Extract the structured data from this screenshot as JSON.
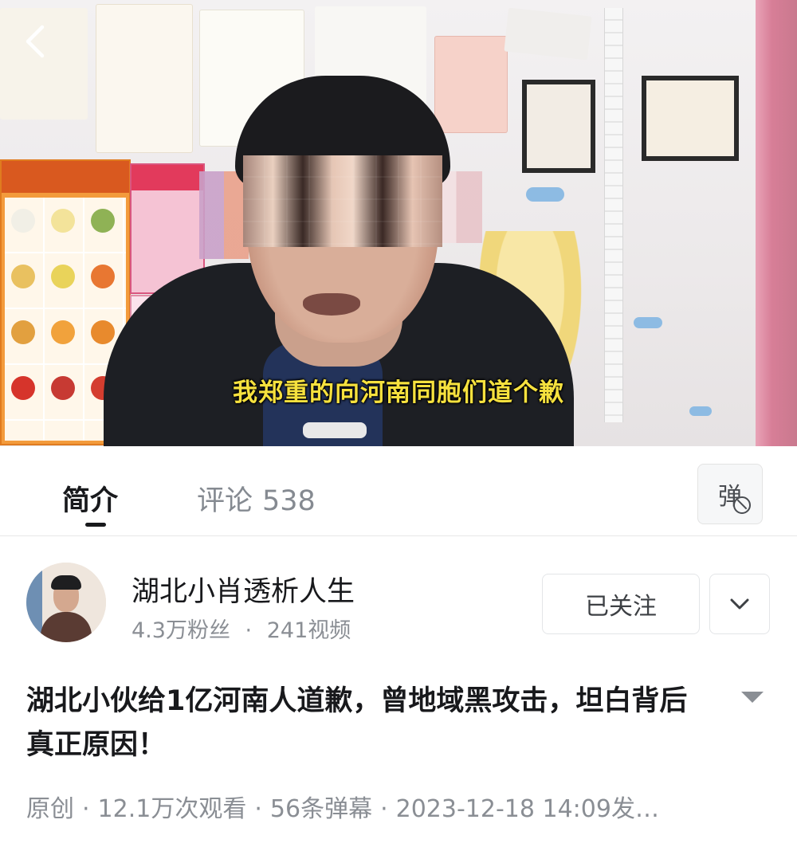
{
  "player": {
    "subtitle": "我郑重的向河南同胞们道个歉",
    "back_icon": "chevron-left-icon"
  },
  "tabs": {
    "intro_label": "简介",
    "comments_label": "评论",
    "comments_count": "538",
    "danmaku_label": "弹"
  },
  "uploader": {
    "name": "湖北小肖透析人生",
    "fans": "4.3万粉丝",
    "videos": "241视频",
    "separator": "·",
    "follow_label": "已关注"
  },
  "video": {
    "title": "湖北小伙给1亿河南人道歉，曾地域黑攻击，坦白背后真正原因！",
    "meta": {
      "original": "原创",
      "views": "12.1万次观看",
      "danmaku": "56条弹幕",
      "published": "2023-12-18 14:09发…",
      "separator": "·"
    }
  },
  "colors": {
    "subtitle": "#f6e13e",
    "text_primary": "#18191c",
    "text_secondary": "#8a8e94"
  }
}
